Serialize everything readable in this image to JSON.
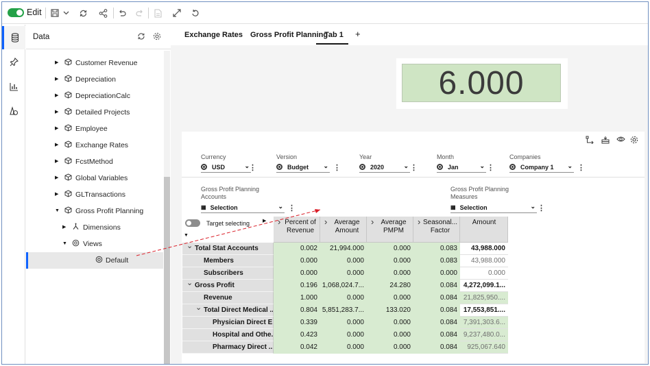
{
  "toolbar": {
    "edit_label": "Edit"
  },
  "data_panel": {
    "title": "Data",
    "items": [
      {
        "label": "Customer Revenue",
        "icon": "cube-icon",
        "caret": "▶",
        "level": 0
      },
      {
        "label": "Depreciation",
        "icon": "cube-icon",
        "caret": "▶",
        "level": 0
      },
      {
        "label": "DepreciationCalc",
        "icon": "cube-icon",
        "caret": "▶",
        "level": 0
      },
      {
        "label": "Detailed Projects",
        "icon": "cube-icon",
        "caret": "▶",
        "level": 0
      },
      {
        "label": "Employee",
        "icon": "cube-icon",
        "caret": "▶",
        "level": 0
      },
      {
        "label": "Exchange Rates",
        "icon": "cube-icon",
        "caret": "▶",
        "level": 0
      },
      {
        "label": "FcstMethod",
        "icon": "cube-icon",
        "caret": "▶",
        "level": 0
      },
      {
        "label": "Global Variables",
        "icon": "cube-icon",
        "caret": "▶",
        "level": 0
      },
      {
        "label": "GLTransactions",
        "icon": "cube-icon",
        "caret": "▶",
        "level": 0
      },
      {
        "label": "Gross Profit Planning",
        "icon": "cube-icon",
        "caret": "▼",
        "level": 0
      },
      {
        "label": "Dimensions",
        "icon": "hierarchy-icon",
        "caret": "▶",
        "level": 1
      },
      {
        "label": "Views",
        "icon": "view-icon",
        "caret": "▼",
        "level": 1
      },
      {
        "label": "Default",
        "icon": "view-icon",
        "caret": "",
        "level": 2,
        "selected": true
      }
    ]
  },
  "tabs": [
    {
      "label": "Exchange Rates"
    },
    {
      "label": "Gross Profit Planning"
    },
    {
      "label": "Tab 1",
      "active": true
    }
  ],
  "add_tab_label": "+",
  "kpi": {
    "value": "6.000"
  },
  "filters": {
    "currency": {
      "label": "Currency",
      "value": "USD"
    },
    "version": {
      "label": "Version",
      "value": "Budget"
    },
    "year": {
      "label": "Year",
      "value": "2020"
    },
    "month": {
      "label": "Month",
      "value": "Jan"
    },
    "companies": {
      "label": "Companies",
      "value": "Company 1"
    },
    "accounts": {
      "label_line1": "Gross Profit Planning",
      "label_line2": "Accounts",
      "value": "Selection"
    },
    "measures": {
      "label_line1": "Gross Profit Planning",
      "label_line2": "Measures",
      "value": "Selection"
    }
  },
  "grid": {
    "target_selecting_label": "Target selecting",
    "columns": [
      {
        "line1": "Percent of",
        "line2": "Revenue"
      },
      {
        "line1": "Average",
        "line2": "Amount"
      },
      {
        "line1": "Average",
        "line2": "PMPM"
      },
      {
        "line1": "Seasonal...",
        "line2": "Factor"
      },
      {
        "line1": "Amount",
        "line2": ""
      }
    ],
    "rows": [
      {
        "label": "Total Stat Accounts",
        "indent": 0,
        "expander": "⌄",
        "bold": true,
        "values": [
          "0.002",
          "21,994.000",
          "0.000",
          "0.083",
          "43,988.000"
        ],
        "amount_style": "bold"
      },
      {
        "label": "Members",
        "indent": 1,
        "expander": "",
        "bold": true,
        "values": [
          "0.000",
          "0.000",
          "0.000",
          "0.083",
          "43,988.000"
        ],
        "amount_style": "light"
      },
      {
        "label": "Subscribers",
        "indent": 1,
        "expander": "",
        "bold": true,
        "values": [
          "0.000",
          "0.000",
          "0.000",
          "0.000",
          "0.000"
        ],
        "amount_style": "light"
      },
      {
        "label": "Gross Profit",
        "indent": 0,
        "expander": "⌄",
        "bold": true,
        "values": [
          "0.196",
          "1,068,024.7...",
          "24.280",
          "0.084",
          "4,272,099.1..."
        ],
        "amount_style": "bold"
      },
      {
        "label": "Revenue",
        "indent": 1,
        "expander": "",
        "bold": true,
        "values": [
          "1.000",
          "0.000",
          "0.000",
          "0.084",
          "21,825,950...."
        ],
        "amount_style": "green"
      },
      {
        "label": "Total Direct Medical ...",
        "indent": 1,
        "expander": "⌄",
        "bold": true,
        "values": [
          "0.804",
          "5,851,283.7...",
          "133.020",
          "0.084",
          "17,553,851...."
        ],
        "amount_style": "bold"
      },
      {
        "label": "Physician Direct E...",
        "indent": 2,
        "expander": "",
        "bold": true,
        "values": [
          "0.339",
          "0.000",
          "0.000",
          "0.084",
          "7,391,303.6..."
        ],
        "amount_style": "green"
      },
      {
        "label": "Hospital and Othe...",
        "indent": 2,
        "expander": "",
        "bold": true,
        "values": [
          "0.423",
          "0.000",
          "0.000",
          "0.084",
          "9,237,480.0..."
        ],
        "amount_style": "green"
      },
      {
        "label": "Pharmacy Direct ...",
        "indent": 2,
        "expander": "",
        "bold": true,
        "values": [
          "0.042",
          "0.000",
          "0.000",
          "0.084",
          "925,067.640"
        ],
        "amount_style": "green"
      }
    ]
  },
  "colors": {
    "accent": "#0f62fe",
    "toggle_on": "#24a148",
    "kpi_fill": "#cfe5c4",
    "cell_green": "#d8ebd1",
    "arrow": "#da1e28"
  }
}
